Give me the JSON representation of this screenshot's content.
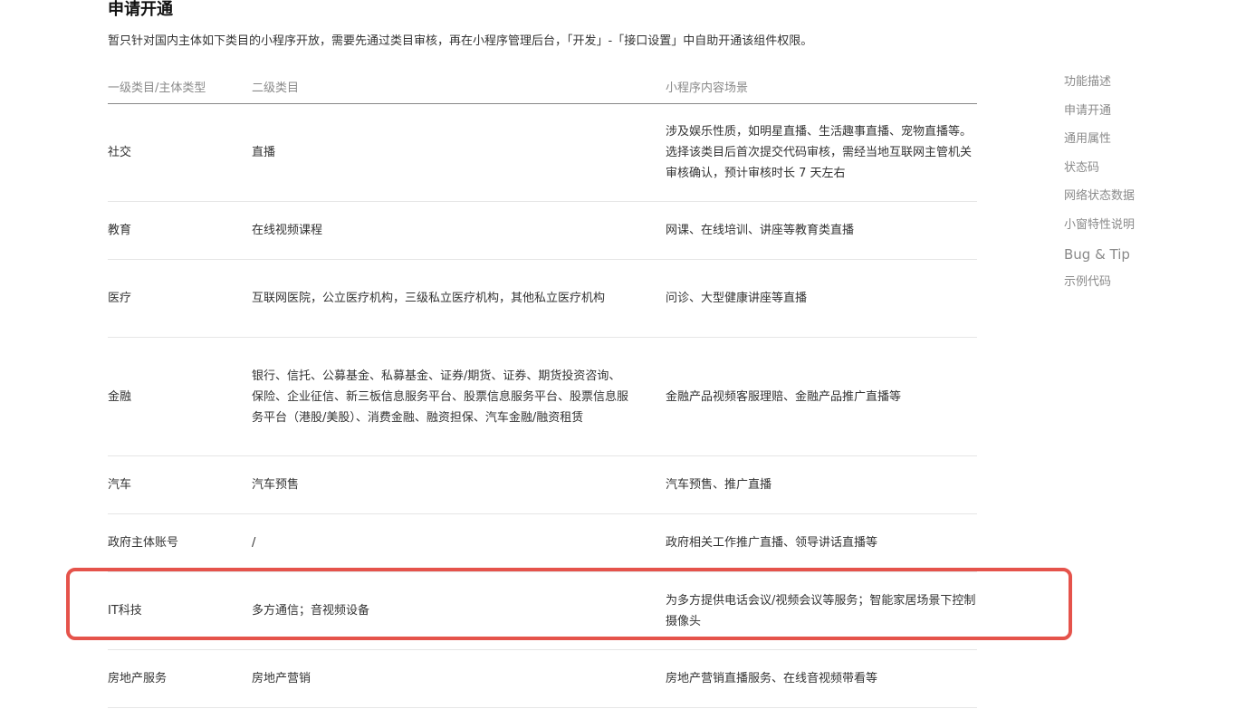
{
  "section": {
    "title": "申请开通",
    "description": "暂只针对国内主体如下类目的小程序开放，需要先通过类目审核，再在小程序管理后台，「开发」-「接口设置」中自助开通该组件权限。"
  },
  "table": {
    "headers": [
      "一级类目/主体类型",
      "二级类目",
      "小程序内容场景"
    ],
    "rows": [
      {
        "c1": "社交",
        "c2": "直播",
        "c3": "涉及娱乐性质，如明星直播、生活趣事直播、宠物直播等。选择该类目后首次提交代码审核，需经当地互联网主管机关审核确认，预计审核时长 7 天左右"
      },
      {
        "c1": "教育",
        "c2": "在线视频课程",
        "c3": "网课、在线培训、讲座等教育类直播"
      },
      {
        "c1": "医疗",
        "c2": "互联网医院，公立医疗机构，三级私立医疗机构，其他私立医疗机构",
        "c3": "问诊、大型健康讲座等直播"
      },
      {
        "c1": "金融",
        "c2": "银行、信托、公募基金、私募基金、证券/期货、证券、期货投资咨询、保险、企业征信、新三板信息服务平台、股票信息服务平台、股票信息服务平台（港股/美股）、消费金融、融资担保、汽车金融/融资租赁",
        "c3": "金融产品视频客服理赔、金融产品推广直播等"
      },
      {
        "c1": "汽车",
        "c2": "汽车预售",
        "c3": "汽车预售、推广直播"
      },
      {
        "c1": "政府主体账号",
        "c2": "/",
        "c3": "政府相关工作推广直播、领导讲话直播等"
      },
      {
        "c1": "IT科技",
        "c2": "多方通信；音视频设备",
        "c3": "为多方提供电话会议/视频会议等服务；智能家居场景下控制摄像头"
      },
      {
        "c1": "房地产服务",
        "c2": "房地产营销",
        "c3": "房地产营销直播服务、在线音视频带看等"
      }
    ]
  },
  "toc": {
    "items": [
      "功能描述",
      "申请开通",
      "通用属性",
      "状态码",
      "网络状态数据",
      "小窗特性说明",
      "Bug & Tip",
      "示例代码"
    ]
  },
  "colors": {
    "highlight": "#e5534b",
    "toc_text": "#8a8a8a"
  }
}
